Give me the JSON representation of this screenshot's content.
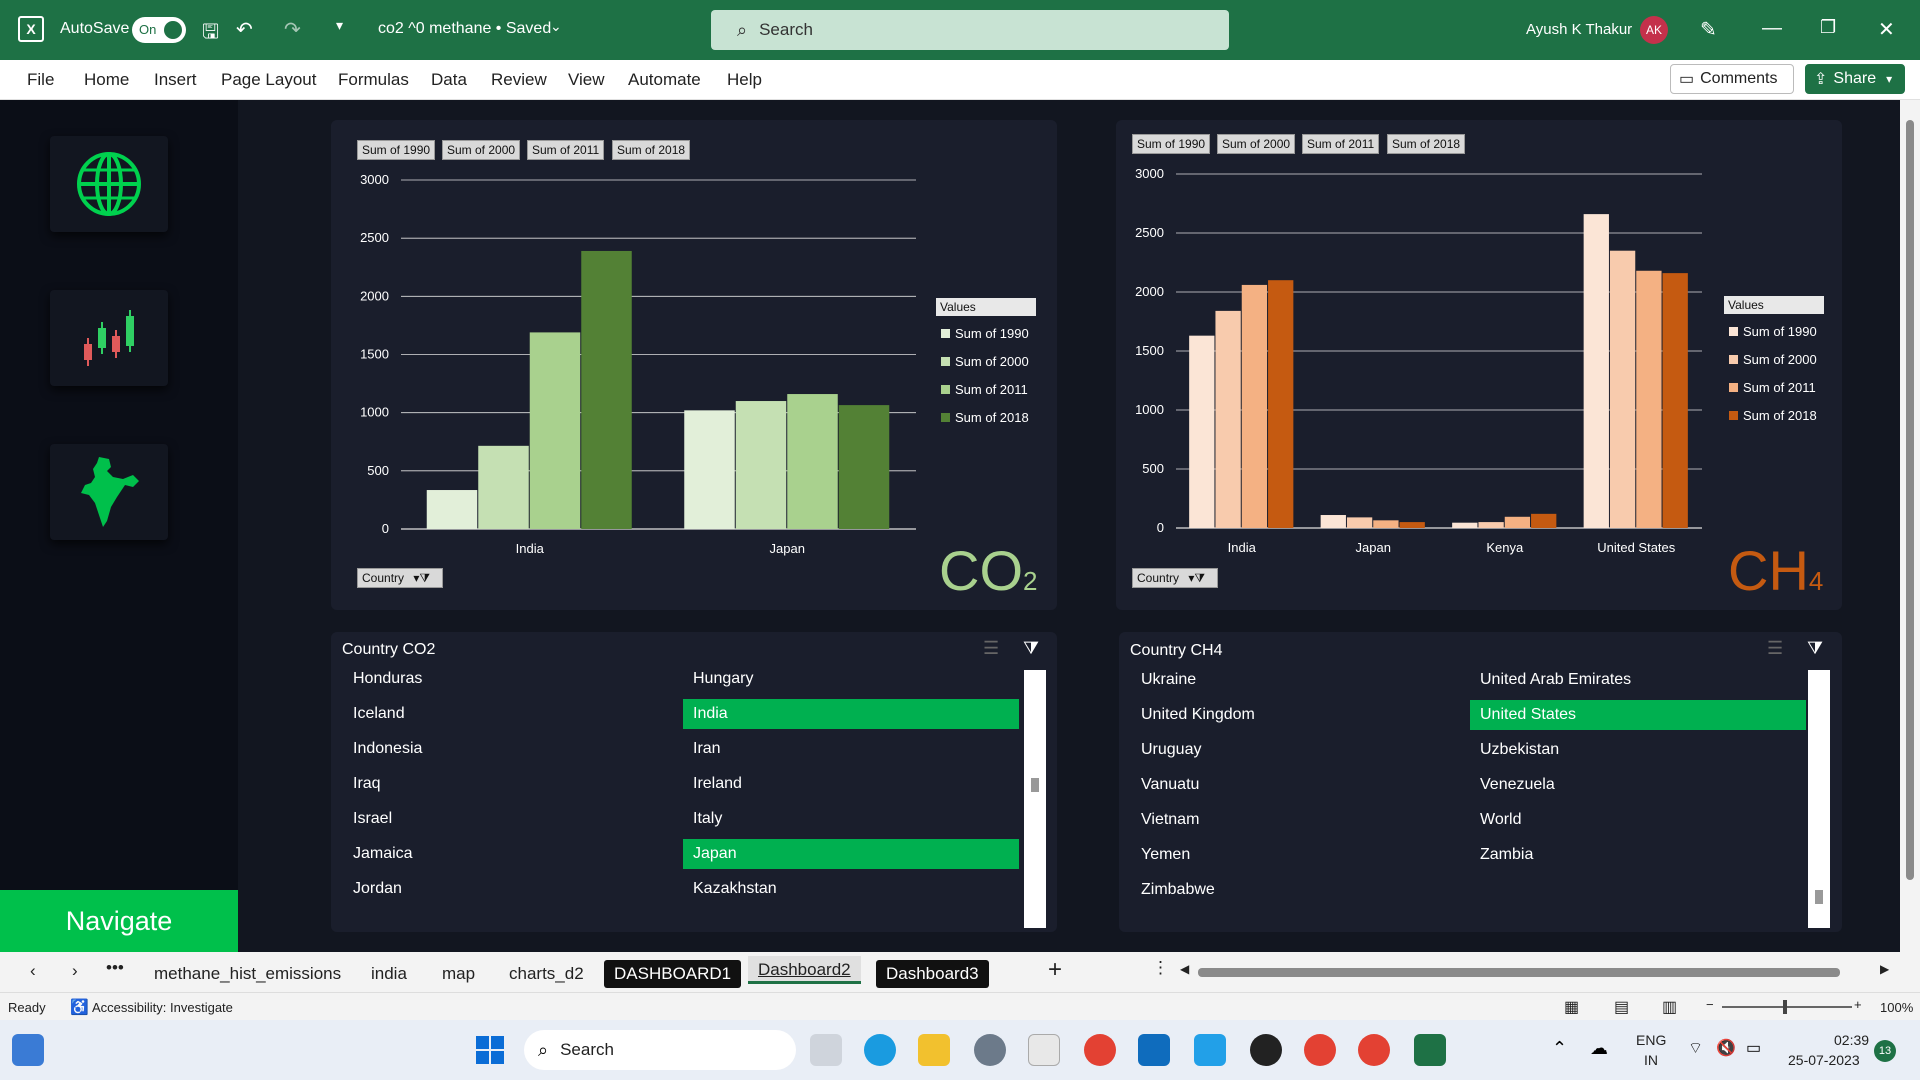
{
  "window": {
    "autosave_label": "AutoSave",
    "autosave_state": "On",
    "title": "co2 ^0 methane • Saved",
    "search_placeholder": "Search",
    "user_name": "Ayush K Thakur",
    "user_initials": "AK"
  },
  "ribbon": {
    "tabs": [
      "File",
      "Home",
      "Insert",
      "Page Layout",
      "Formulas",
      "Data",
      "Review",
      "View",
      "Automate",
      "Help"
    ],
    "comments_label": "Comments",
    "share_label": "Share"
  },
  "sidebar": {
    "tiles": [
      "globe-icon",
      "candlestick-icon",
      "india-map-icon"
    ],
    "navigate_label": "Navigate"
  },
  "co2_chart": {
    "field_buttons": [
      "Sum of 1990",
      "Sum of 2000",
      "Sum of 2011",
      "Sum of 2018"
    ],
    "filter_button": "Country",
    "legend_title": "Values",
    "big_label_main": "CO",
    "big_label_sub": "2",
    "colors": [
      "#e2efd9",
      "#c5e0b3",
      "#a9d18e",
      "#538135"
    ]
  },
  "ch4_chart": {
    "field_buttons": [
      "Sum of 1990",
      "Sum of 2000",
      "Sum of 2011",
      "Sum of 2018"
    ],
    "filter_button": "Country",
    "legend_title": "Values",
    "big_label_main": "CH",
    "big_label_sub": "4",
    "colors": [
      "#fbe5d6",
      "#f8cbad",
      "#f4b183",
      "#c55a11"
    ]
  },
  "chart_data": [
    {
      "type": "bar",
      "categories": [
        "India",
        "Japan"
      ],
      "series": [
        {
          "name": "Sum of 1990",
          "values": [
            335,
            1020
          ]
        },
        {
          "name": "Sum of 2000",
          "values": [
            715,
            1100
          ]
        },
        {
          "name": "Sum of 2011",
          "values": [
            1690,
            1160
          ]
        },
        {
          "name": "Sum of 2018",
          "values": [
            2390,
            1065
          ]
        }
      ],
      "ylim": [
        0,
        3000
      ],
      "yticks": [
        "0",
        "500",
        "1000",
        "1500",
        "2000",
        "2500",
        "3000"
      ],
      "grid": true,
      "legend": "right"
    },
    {
      "type": "bar",
      "categories": [
        "India",
        "Japan",
        "Kenya",
        "United States"
      ],
      "series": [
        {
          "name": "Sum of 1990",
          "values": [
            1630,
            110,
            45,
            2660
          ]
        },
        {
          "name": "Sum of 2000",
          "values": [
            1840,
            90,
            50,
            2350
          ]
        },
        {
          "name": "Sum of 2011",
          "values": [
            2060,
            65,
            95,
            2180
          ]
        },
        {
          "name": "Sum of 2018",
          "values": [
            2100,
            50,
            120,
            2160
          ]
        }
      ],
      "ylim": [
        0,
        3000
      ],
      "yticks": [
        "0",
        "500",
        "1000",
        "1500",
        "2000",
        "2500",
        "3000"
      ],
      "grid": true,
      "legend": "right"
    }
  ],
  "slicer_co2": {
    "title": "Country CO2",
    "col1": [
      "Honduras",
      "Iceland",
      "Indonesia",
      "Iraq",
      "Israel",
      "Jamaica",
      "Jordan"
    ],
    "col2": [
      "Hungary",
      "India",
      "Iran",
      "Ireland",
      "Italy",
      "Japan",
      "Kazakhstan"
    ],
    "selected": [
      "India",
      "Japan"
    ]
  },
  "slicer_ch4": {
    "title": "Country CH4",
    "col1": [
      "Ukraine",
      "United Kingdom",
      "Uruguay",
      "Vanuatu",
      "Vietnam",
      "Yemen",
      "Zimbabwe"
    ],
    "col2": [
      "United Arab Emirates",
      "United States",
      "Uzbekistan",
      "Venezuela",
      "World",
      "Zambia"
    ],
    "selected": [
      "United States"
    ]
  },
  "sheet_tabs": [
    "methane_hist_emissions",
    "india",
    "map",
    "charts_d2",
    "DASHBOARD1",
    "Dashboard2",
    "Dashboard3"
  ],
  "status": {
    "ready": "Ready",
    "accessibility": "Accessibility: Investigate",
    "zoom": "100%"
  },
  "taskbar": {
    "search_label": "Search",
    "lang_line1": "ENG",
    "lang_line2": "IN",
    "time": "02:39",
    "date": "25-07-2023",
    "notif_count": "13"
  }
}
